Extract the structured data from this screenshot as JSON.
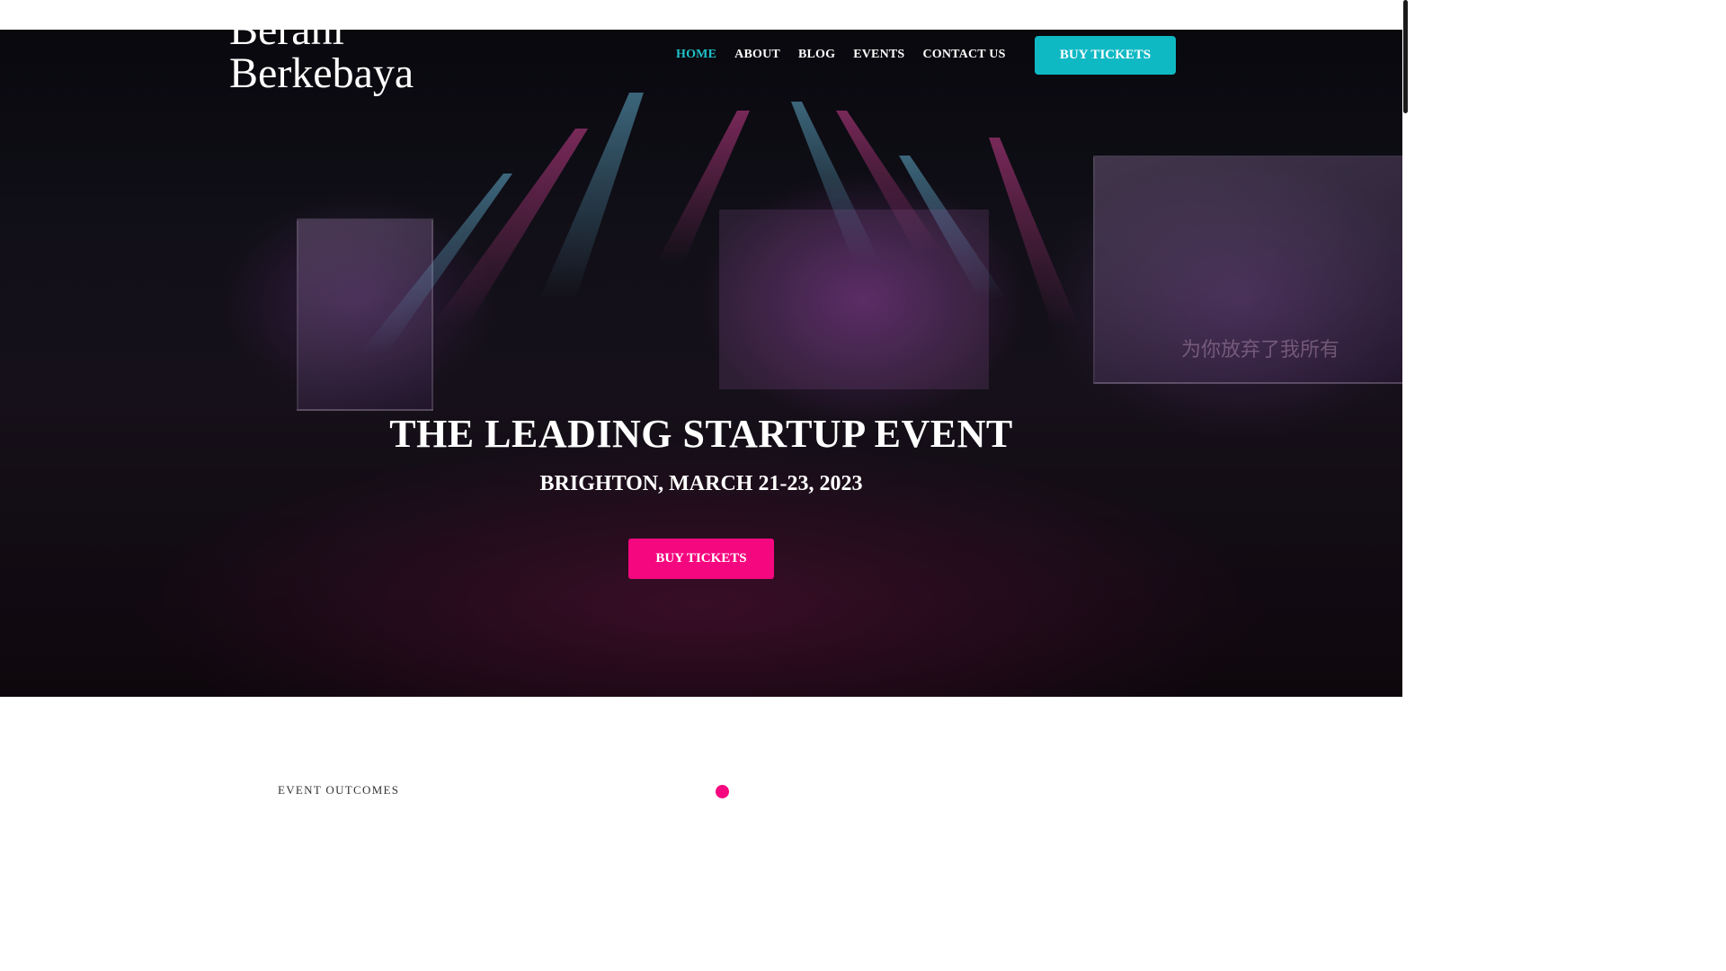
{
  "brand": {
    "line1": "Berani",
    "line2": "Berkebaya"
  },
  "nav": {
    "items": [
      {
        "label": "HOME",
        "active": true
      },
      {
        "label": "ABOUT",
        "active": false
      },
      {
        "label": "BLOG",
        "active": false
      },
      {
        "label": "EVENTS",
        "active": false
      },
      {
        "label": "CONTACT US",
        "active": false
      }
    ],
    "cta_label": "BUY TICKETS"
  },
  "hero": {
    "title": "THE LEADING STARTUP EVENT",
    "subtitle": "BRIGHTON, MARCH 21-23, 2023",
    "cta_label": "BUY TICKETS",
    "screen_text": "为你放弃了我所有"
  },
  "section": {
    "label": "EVENT OUTCOMES"
  },
  "colors": {
    "accent_teal": "#0fb9c4",
    "active_nav": "#21c2cb",
    "accent_pink": "#f5077f"
  },
  "icons": {
    "section_marker": "dot-icon"
  }
}
